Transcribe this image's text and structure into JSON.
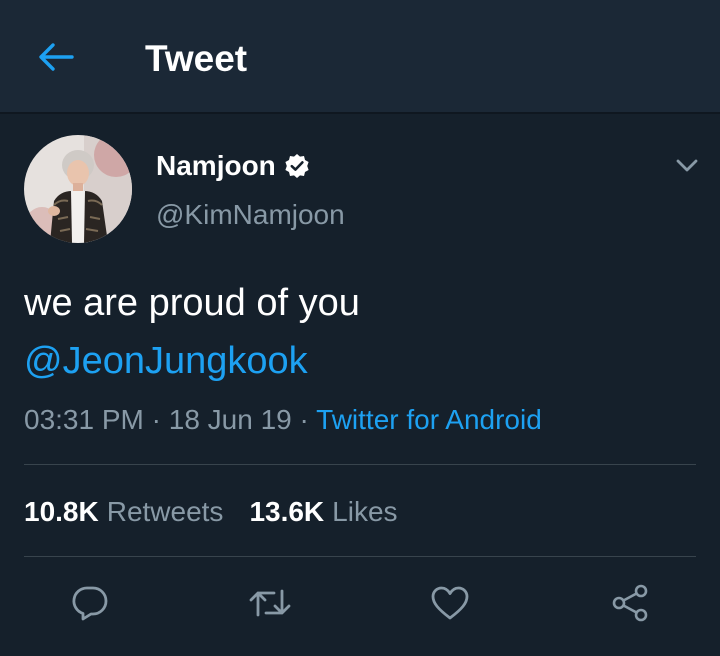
{
  "header": {
    "title": "Tweet",
    "back_icon": "arrow-left-icon",
    "accent": "#1da1f2"
  },
  "author": {
    "display_name": "Namjoon",
    "username": "@KimNamjoon",
    "verified_icon": "verified-badge-icon"
  },
  "tweet": {
    "text": "we are proud of you",
    "mention": "@JeonJungkook",
    "time": "03:31 PM",
    "separator": "·",
    "date": "18 Jun 19",
    "source": "Twitter for Android"
  },
  "stats": {
    "retweets_count": "10.8K",
    "retweets_label": "Retweets",
    "likes_count": "13.6K",
    "likes_label": "Likes"
  },
  "actions": [
    {
      "icon": "reply-icon"
    },
    {
      "icon": "retweet-icon"
    },
    {
      "icon": "like-icon"
    },
    {
      "icon": "share-icon"
    }
  ],
  "colors": {
    "background": "#15202b",
    "header_background": "#1b2836",
    "secondary_text": "#8899a6",
    "link": "#1da1f2",
    "divider": "#38444d"
  }
}
